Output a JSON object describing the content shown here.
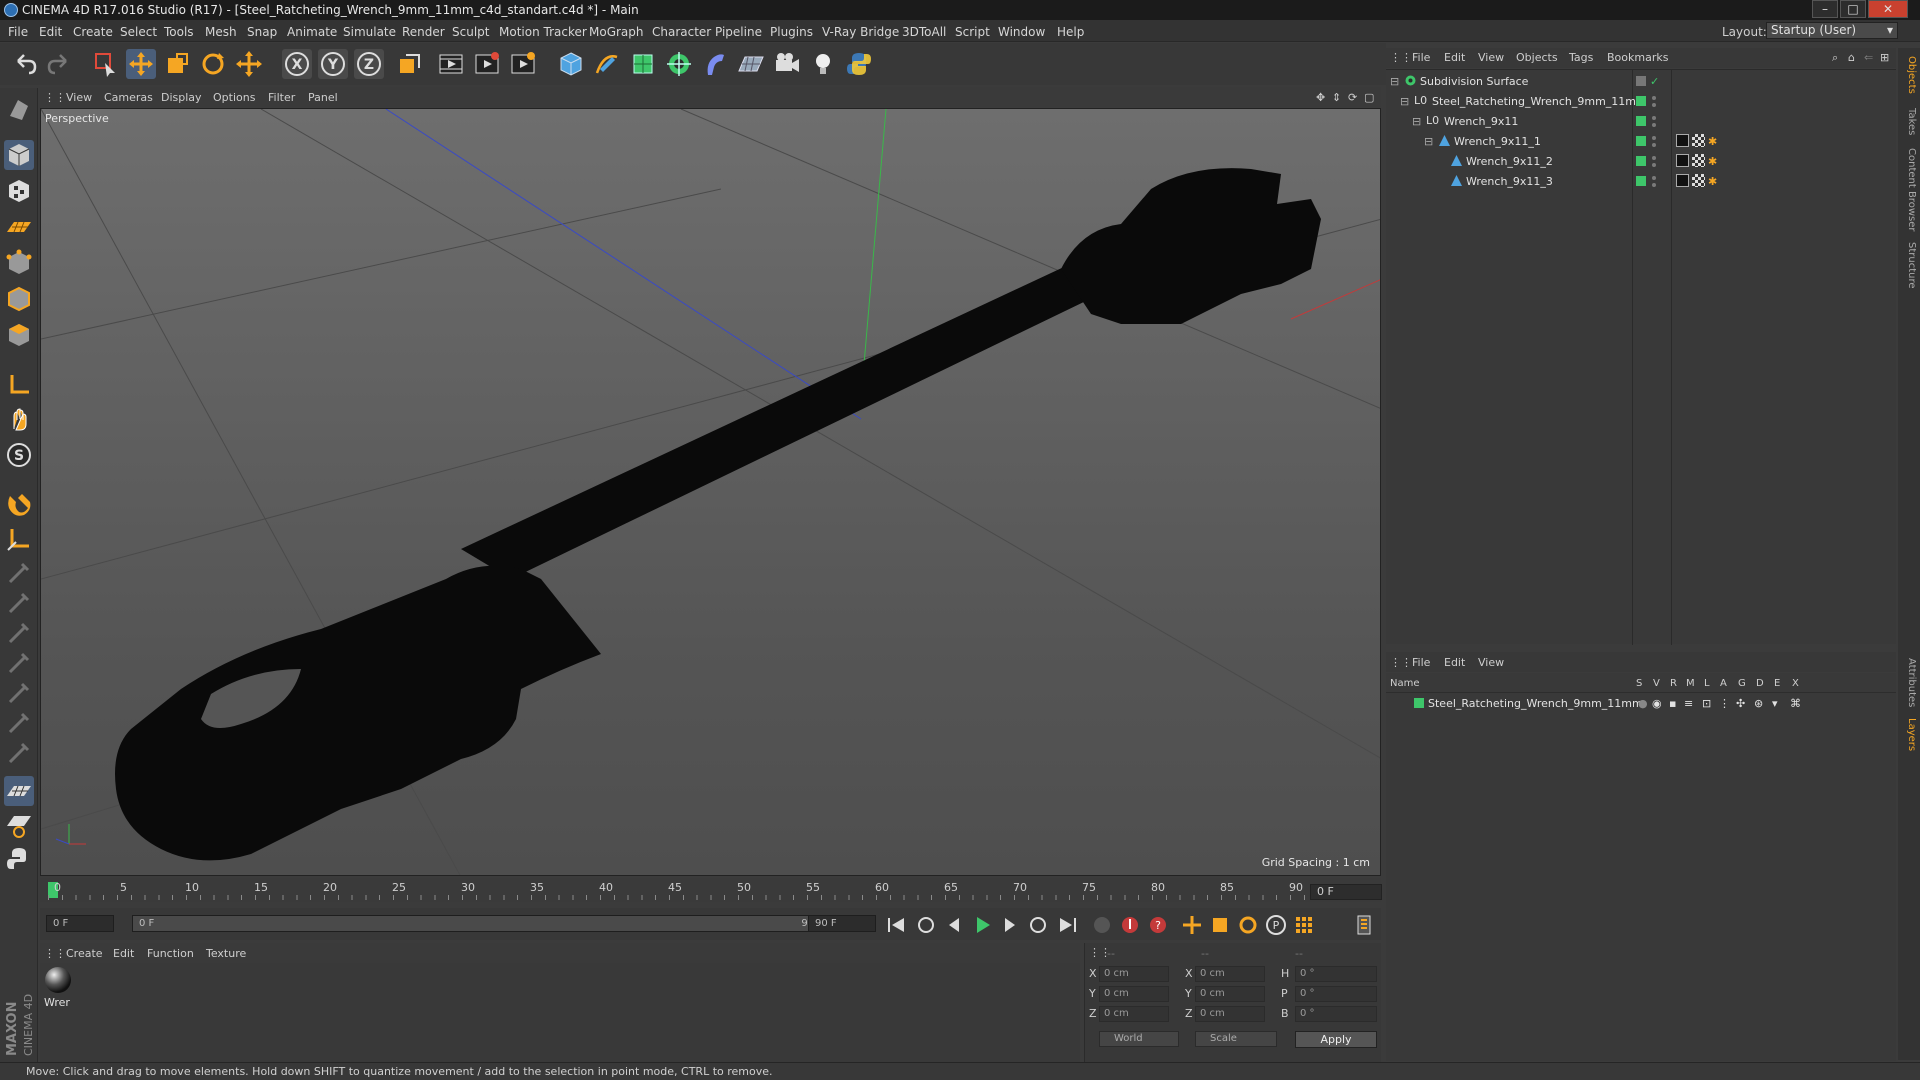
{
  "window": {
    "title": "CINEMA 4D R17.016 Studio (R17) - [Steel_Ratcheting_Wrench_9mm_11mm_c4d_standart.c4d *] - Main",
    "minimize": "–",
    "maximize": "□",
    "close": "✕"
  },
  "menubar": {
    "items": [
      "File",
      "Edit",
      "Create",
      "Select",
      "Tools",
      "Mesh",
      "Snap",
      "Animate",
      "Simulate",
      "Render",
      "Sculpt",
      "Motion Tracker",
      "MoGraph",
      "Character",
      "Pipeline",
      "Plugins",
      "V-Ray Bridge",
      "3DToAll",
      "Script",
      "Window",
      "Help"
    ],
    "layout_label": "Layout:",
    "layout_value": "Startup (User)"
  },
  "toolbar": {
    "icons": [
      "undo-icon",
      "redo-icon",
      "live-selection-icon",
      "move-icon",
      "scale-icon",
      "rotate-icon",
      "transform-icon",
      "x-axis-icon",
      "y-axis-icon",
      "z-axis-icon",
      "coordinate-system-icon",
      "render-view-icon",
      "render-picture-viewer-icon",
      "render-settings-icon",
      "cube-icon",
      "pen-icon",
      "subdivision-icon",
      "cloner-icon",
      "deformer-icon",
      "floor-icon",
      "camera-icon",
      "light-icon",
      "python-icon"
    ]
  },
  "viewport": {
    "menu": [
      "View",
      "Cameras",
      "Display",
      "Options",
      "Filter",
      "Panel"
    ],
    "label": "Perspective",
    "grid_spacing": "Grid Spacing : 1 cm"
  },
  "timeline": {
    "ticks": [
      "0",
      "5",
      "10",
      "15",
      "20",
      "25",
      "30",
      "35",
      "40",
      "45",
      "50",
      "55",
      "60",
      "65",
      "70",
      "75",
      "80",
      "85",
      "90"
    ],
    "current_frame": "0 F",
    "start_field": "0 F",
    "range_start": "0 F",
    "range_end": "90 F",
    "end_field": "90 F"
  },
  "material_manager": {
    "menu": [
      "Create",
      "Edit",
      "Function",
      "Texture"
    ],
    "material_name": "Wrer"
  },
  "coordinates": {
    "header": [
      "--",
      "--",
      "--"
    ],
    "rows": [
      {
        "axis": "X",
        "pos": "0 cm",
        "size_axis": "X",
        "size": "0 cm",
        "rot_axis": "H",
        "rot": "0 °"
      },
      {
        "axis": "Y",
        "pos": "0 cm",
        "size_axis": "Y",
        "size": "0 cm",
        "rot_axis": "P",
        "rot": "0 °"
      },
      {
        "axis": "Z",
        "pos": "0 cm",
        "size_axis": "Z",
        "size": "0 cm",
        "rot_axis": "B",
        "rot": "0 °"
      }
    ],
    "world": "World",
    "scale": "Scale",
    "apply": "Apply"
  },
  "object_manager": {
    "menu": [
      "File",
      "Edit",
      "View",
      "Objects",
      "Tags",
      "Bookmarks"
    ],
    "objects": [
      {
        "name": "Subdivision Surface",
        "indent": 0
      },
      {
        "name": "Steel_Ratcheting_Wrench_9mm_11mm",
        "indent": 1
      },
      {
        "name": "Wrench_9x11",
        "indent": 2
      },
      {
        "name": "Wrench_9x11_1",
        "indent": 3
      },
      {
        "name": "Wrench_9x11_2",
        "indent": 4
      },
      {
        "name": "Wrench_9x11_3",
        "indent": 4
      }
    ]
  },
  "layer_manager": {
    "menu": [
      "File",
      "Edit",
      "View"
    ],
    "header_name": "Name",
    "header_cols": [
      "S",
      "V",
      "R",
      "M",
      "L",
      "A",
      "G",
      "D",
      "E",
      "X"
    ],
    "layers": [
      {
        "name": "Steel_Ratcheting_Wrench_9mm_11mm",
        "color": "#3ec66a"
      }
    ]
  },
  "right_tabs": [
    "Objects",
    "Takes",
    "Content Browser",
    "Structure",
    "Attributes",
    "Layers"
  ],
  "status": "Move: Click and drag to move elements. Hold down SHIFT to quantize movement / add to the selection in point mode, CTRL to remove.",
  "logo": "MAXON CINEMA 4D",
  "colors": {
    "accent": "#f5a623",
    "object_green": "#3ec66a",
    "axis_x": "#c43a3a",
    "axis_y": "#3ab84a",
    "axis_z": "#3a4ac4"
  }
}
